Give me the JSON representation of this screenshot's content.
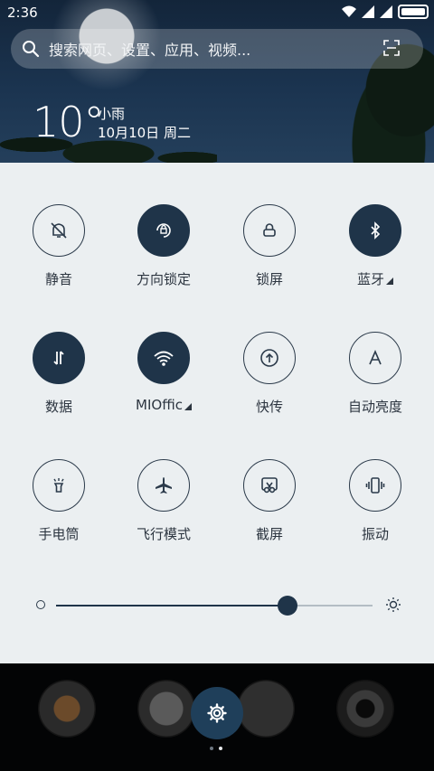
{
  "status_bar": {
    "time": "2:36"
  },
  "search": {
    "placeholder": "搜索网页、设置、应用、视频..."
  },
  "weather": {
    "temperature": "10°",
    "condition": "小雨",
    "date": "10月10日 周二"
  },
  "quick_settings": [
    {
      "id": "mute",
      "label": "静音",
      "icon": "bell-off-icon",
      "on": false
    },
    {
      "id": "rotation-lock",
      "label": "方向锁定",
      "icon": "rotation-lock-icon",
      "on": true
    },
    {
      "id": "lock-screen",
      "label": "锁屏",
      "icon": "lock-icon",
      "on": false
    },
    {
      "id": "bluetooth",
      "label": "蓝牙",
      "icon": "bluetooth-icon",
      "on": true,
      "has_more": true
    },
    {
      "id": "mobile-data",
      "label": "数据",
      "icon": "data-arrows-icon",
      "on": true
    },
    {
      "id": "wifi",
      "label": "MIOffic",
      "icon": "wifi-icon",
      "on": true,
      "has_more": true
    },
    {
      "id": "quick-transfer",
      "label": "快传",
      "icon": "upload-icon",
      "on": false
    },
    {
      "id": "auto-brightness",
      "label": "自动亮度",
      "icon": "auto-brightness-icon",
      "on": false
    },
    {
      "id": "flashlight",
      "label": "手电筒",
      "icon": "flashlight-icon",
      "on": false
    },
    {
      "id": "airplane-mode",
      "label": "飞行模式",
      "icon": "airplane-icon",
      "on": false
    },
    {
      "id": "screenshot",
      "label": "截屏",
      "icon": "scissors-icon",
      "on": false
    },
    {
      "id": "vibrate",
      "label": "振动",
      "icon": "vibrate-icon",
      "on": false
    }
  ],
  "brightness": {
    "level": 0.73
  },
  "dock": {
    "page_count": 2,
    "active_page": 1,
    "apps": [
      "app-icon",
      "yin-yang-app-icon",
      "folder-app-icon",
      "camera-app-icon"
    ]
  },
  "colors": {
    "accent": "#1f3449",
    "panel": "#ebeff1",
    "outline": "#2b3a4a"
  }
}
